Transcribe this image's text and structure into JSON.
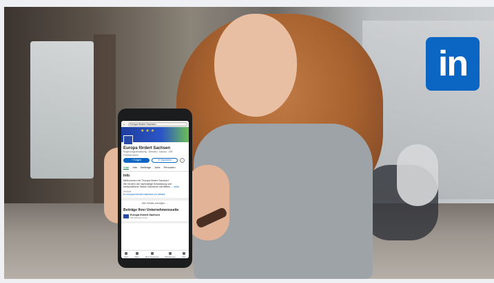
{
  "phone": {
    "search": "Europa fördert Sachsen",
    "page_name": "Europa fördert Sachsen",
    "meta_line1": "Regierungsverwaltung · Dresden, Saxony · 195",
    "meta_line2": "Follower:innen",
    "follow": "+ Folgen",
    "message": "✈ Nachricht",
    "more": "…",
    "tabs": [
      "Start",
      "Info",
      "Beiträge",
      "Jobs",
      "Personen"
    ],
    "info_title": "Info",
    "welcome": "Willkommen bei \"Europa fördert Sachsen\"",
    "desc": "Wir fördern die nachhaltige Entwicklung und wirtschaftliche Stärke Sachsens mit Mitteln ...",
    "desc_more": "mehr",
    "website_label": "Website",
    "website": "ec.europa-foerdert-sachsen.eu details",
    "details": "Alle Details anzeigen →",
    "affil_title": "Beiträge Ihrer Unternehmensseite",
    "affil_name": "Europa fördert Sachsen",
    "affil_sub": "195 Follower:innen",
    "nav": [
      "Start",
      "Video",
      "Mein Netzwerk",
      "Mitteilungen",
      "Jobs"
    ]
  },
  "brand": {
    "logo_text": "in",
    "color": "#0a66c2"
  }
}
